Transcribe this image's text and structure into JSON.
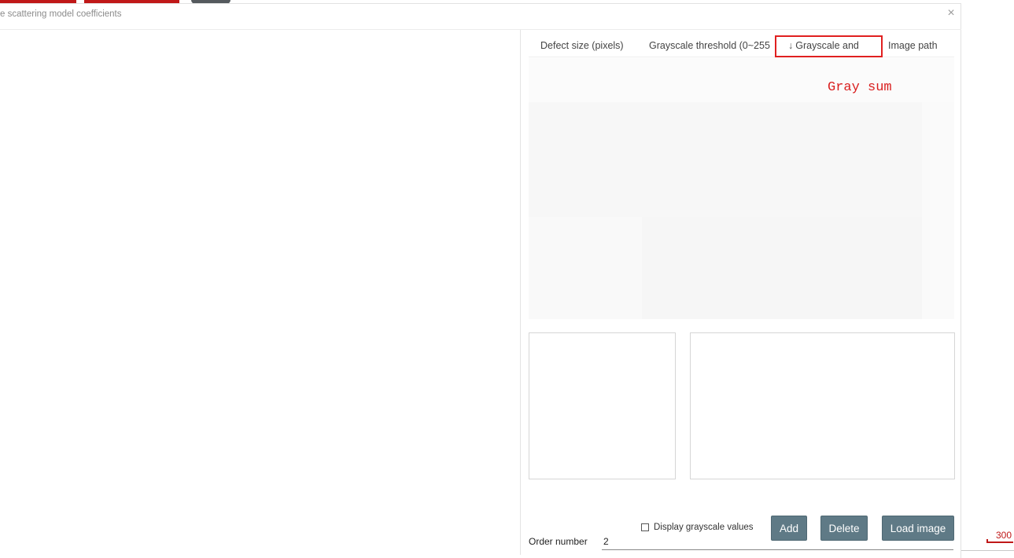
{
  "background": {
    "ruler_value": "300"
  },
  "dialog": {
    "title": "e scattering model coefficients",
    "close_glyph": "×"
  },
  "table": {
    "columns": [
      {
        "label": "Defect size (pixels)"
      },
      {
        "label": "Grayscale threshold (0~255"
      },
      {
        "label": "Grayscale and",
        "sort_indicator": "↓"
      },
      {
        "label": "Image path"
      }
    ],
    "annotation": "Gray sum"
  },
  "controls": {
    "display_grayscale_label": "Display grayscale values",
    "display_grayscale_checked": false,
    "add_label": "Add",
    "delete_label": "Delete",
    "load_image_label": "Load image",
    "order_label": "Order number",
    "order_value": "2"
  },
  "colors": {
    "accent_button": "#5f7a86",
    "highlight": "#e02020",
    "brand_red": "#c01818"
  }
}
